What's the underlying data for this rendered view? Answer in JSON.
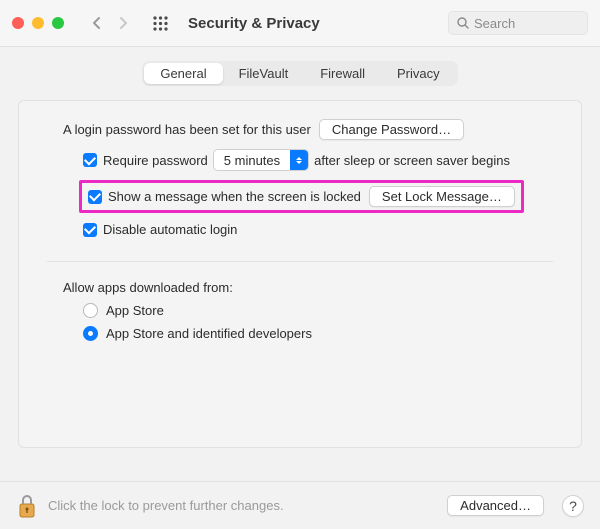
{
  "window": {
    "title": "Security & Privacy",
    "search_placeholder": "Search"
  },
  "tabs": {
    "general": "General",
    "filevault": "FileVault",
    "firewall": "Firewall",
    "privacy": "Privacy"
  },
  "login": {
    "password_set_text": "A login password has been set for this user",
    "change_password_btn": "Change Password…",
    "require_password_label": "Require password",
    "require_password_delay": "5 minutes",
    "require_password_suffix": "after sleep or screen saver begins",
    "show_message_label": "Show a message when the screen is locked",
    "set_lock_message_btn": "Set Lock Message…",
    "disable_auto_login_label": "Disable automatic login"
  },
  "downloads": {
    "heading": "Allow apps downloaded from:",
    "app_store": "App Store",
    "app_store_identified": "App Store and identified developers"
  },
  "footer": {
    "lock_text": "Click the lock to prevent further changes.",
    "advanced_btn": "Advanced…",
    "help": "?"
  }
}
